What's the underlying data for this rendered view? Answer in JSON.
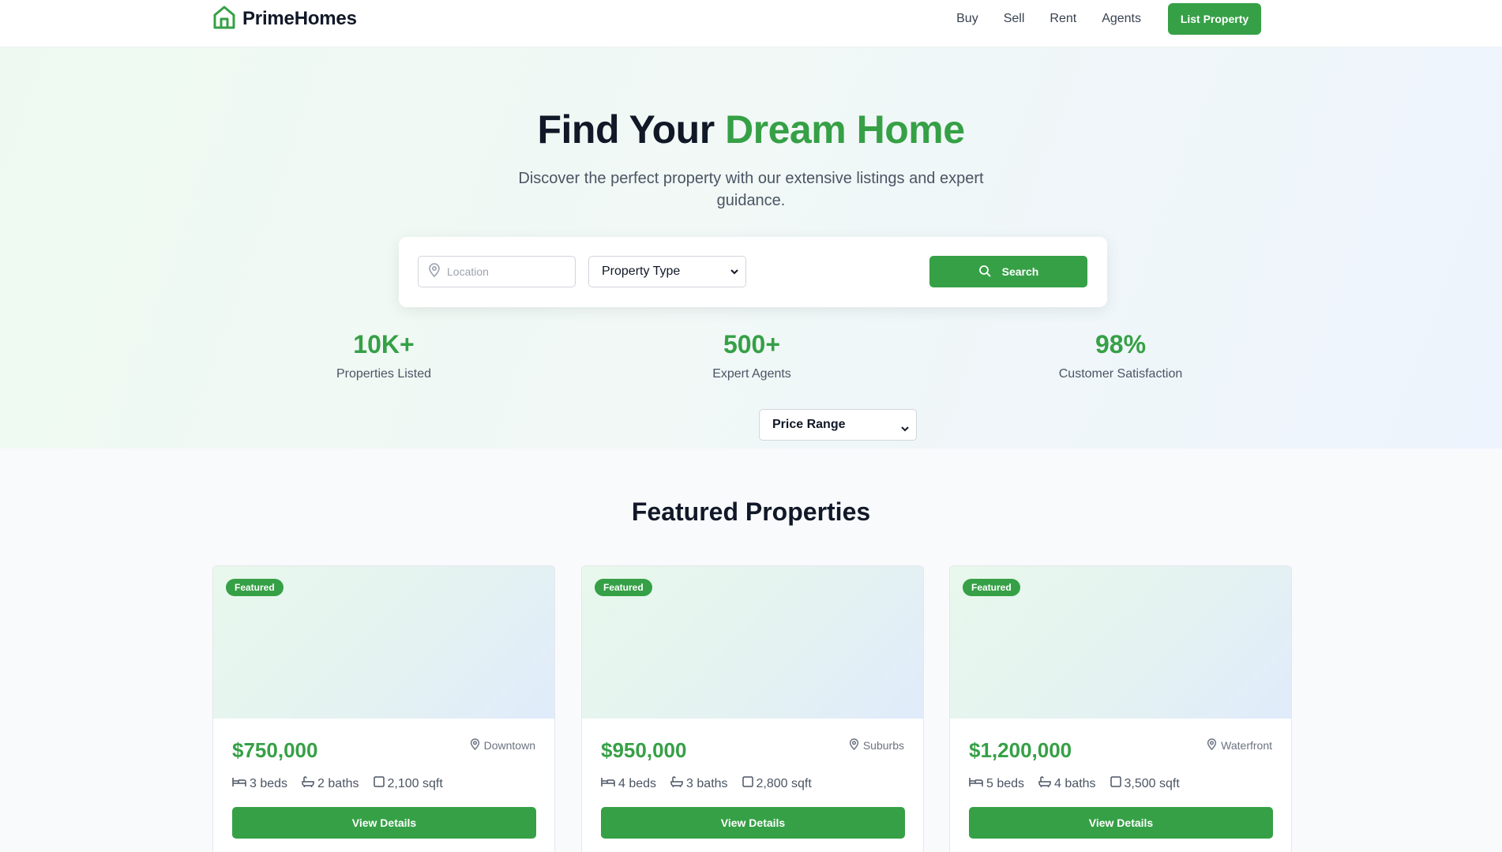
{
  "brand": {
    "name": "PrimeHomes"
  },
  "nav": {
    "links": [
      "Buy",
      "Sell",
      "Rent",
      "Agents"
    ],
    "cta": "List Property"
  },
  "hero": {
    "title_main": "Find Your ",
    "title_accent": "Dream Home",
    "subtitle": "Discover the perfect property with our extensive listings and expert guidance.",
    "search": {
      "location_placeholder": "Location",
      "property_type": "Property Type",
      "price_range": "Price Range",
      "button": "Search"
    },
    "stats": [
      {
        "value": "10K+",
        "label": "Properties Listed"
      },
      {
        "value": "500+",
        "label": "Expert Agents"
      },
      {
        "value": "98%",
        "label": "Customer Satisfaction"
      }
    ]
  },
  "featured": {
    "title": "Featured Properties",
    "cards": [
      {
        "badge": "Featured",
        "price": "$750,000",
        "location": "Downtown",
        "beds": "3 beds",
        "baths": "2 baths",
        "sqft": "2,100 sqft",
        "button": "View Details"
      },
      {
        "badge": "Featured",
        "price": "$950,000",
        "location": "Suburbs",
        "beds": "4 beds",
        "baths": "3 baths",
        "sqft": "2,800 sqft",
        "button": "View Details"
      },
      {
        "badge": "Featured",
        "price": "$1,200,000",
        "location": "Waterfront",
        "beds": "5 beds",
        "baths": "4 baths",
        "sqft": "3,500 sqft",
        "button": "View Details"
      }
    ]
  },
  "colors": {
    "accent": "#36a046",
    "text": "#111827",
    "muted": "#4b5563"
  }
}
